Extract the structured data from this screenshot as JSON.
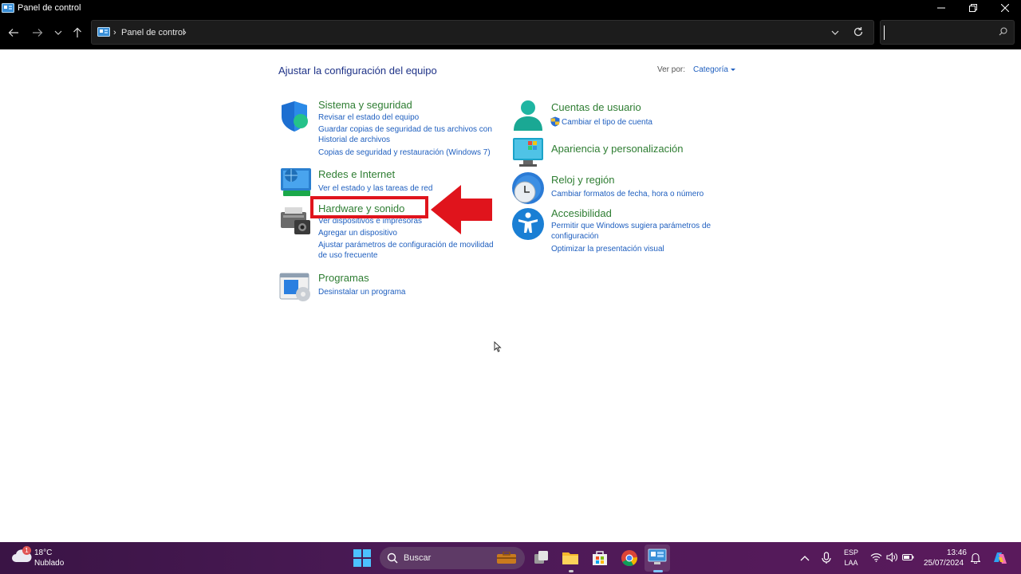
{
  "window": {
    "title": "Panel de control"
  },
  "address": {
    "crumb": "Panel de control",
    "search_placeholder": ""
  },
  "main": {
    "heading": "Ajustar la configuración del equipo",
    "viewby_label": "Ver por:",
    "viewby_value": "Categoría"
  },
  "categories": [
    {
      "title": "Sistema y seguridad",
      "icon": "shield-icon",
      "links": [
        "Revisar el estado del equipo",
        "Guardar copias de seguridad de tus archivos con Historial de archivos",
        "Copias de seguridad y restauración (Windows 7)"
      ]
    },
    {
      "title": "Redes e Internet",
      "icon": "network-icon",
      "links": [
        "Ver el estado y las tareas de red"
      ]
    },
    {
      "title": "Hardware y sonido",
      "icon": "printer-icon",
      "links": [
        "Ver dispositivos e impresoras",
        "Agregar un dispositivo",
        "Ajustar parámetros de configuración de movilidad de uso frecuente"
      ]
    },
    {
      "title": "Programas",
      "icon": "programs-icon",
      "links": [
        "Desinstalar un programa"
      ]
    },
    {
      "title": "Cuentas de usuario",
      "icon": "user-icon",
      "links": [
        "Cambiar el tipo de cuenta"
      ]
    },
    {
      "title": "Apariencia y personalización",
      "icon": "monitor-icon",
      "links": []
    },
    {
      "title": "Reloj y región",
      "icon": "clock-icon",
      "links": [
        "Cambiar formatos de fecha, hora o número"
      ]
    },
    {
      "title": "Accesibilidad",
      "icon": "accessibility-icon",
      "links": [
        "Permitir que Windows sugiera parámetros de configuración",
        "Optimizar la presentación visual"
      ]
    }
  ],
  "taskbar": {
    "weather_badge": "1",
    "temperature": "18°C",
    "weather": "Nublado",
    "search_label": "Buscar",
    "lang_top": "ESP",
    "lang_bottom": "LAA",
    "time": "13:46",
    "date": "25/07/2024"
  },
  "colors": {
    "category_title": "#2e7d32",
    "link": "#1f5fbf",
    "highlight": "#e0141c",
    "heading": "#1e3287"
  }
}
